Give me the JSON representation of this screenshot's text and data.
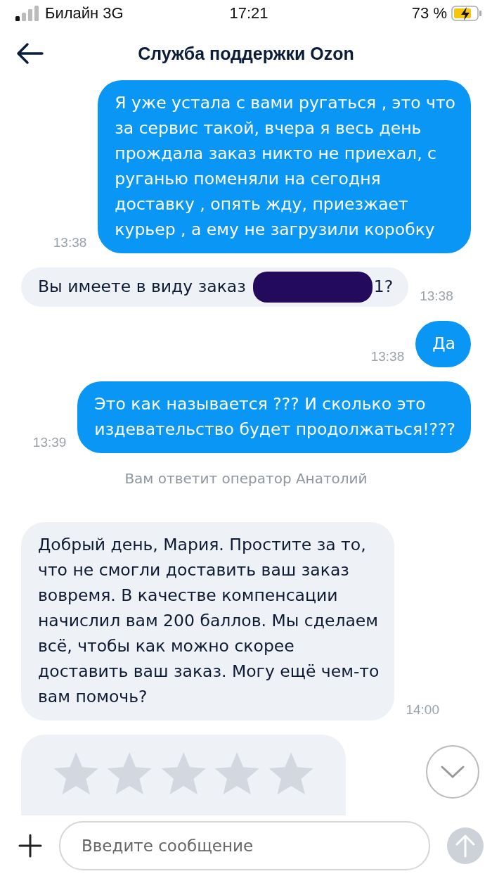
{
  "status_bar": {
    "carrier": "Билайн 3G",
    "time": "17:21",
    "battery": "73 %"
  },
  "header": {
    "title": "Служба поддержки Ozon"
  },
  "messages": [
    {
      "kind": "outgoing",
      "text": "Я уже устала с вами ругаться , это что\nза сервис такой, вчера я весь день\nпрождала заказ никто не приехал, с\nруганью поменяли на сегодня\nдоставку , опять жду, приезжает\nкурьер , а ему не загрузили коробку",
      "time": "13:38"
    },
    {
      "kind": "redacted",
      "text": "Вы имеете в виду заказ",
      "text_after": "1?",
      "time": "13:38"
    },
    {
      "kind": "outgoing",
      "text": "Да",
      "time": "13:38"
    },
    {
      "kind": "outgoing",
      "text": "Это как называется ??? И сколько это\nиздевательство будет продолжаться!???",
      "time": "13:39"
    },
    {
      "kind": "notice",
      "text": "Вам ответит оператор Анатолий"
    },
    {
      "kind": "incoming",
      "text": "Добрый день, Мария. Простите за то,\nчто не смогли доставить ваш заказ\nвовремя. В качестве компенсации\nначислил вам 200 баллов. Мы сделаем\nвсё, чтобы как можно скорее\nдоставить ваш заказ. Могу ещё чем-то\nвам помочь?",
      "time": "14:00"
    },
    {
      "kind": "rating",
      "stars": 0
    }
  ],
  "composer": {
    "placeholder": "Введите сообщение"
  }
}
